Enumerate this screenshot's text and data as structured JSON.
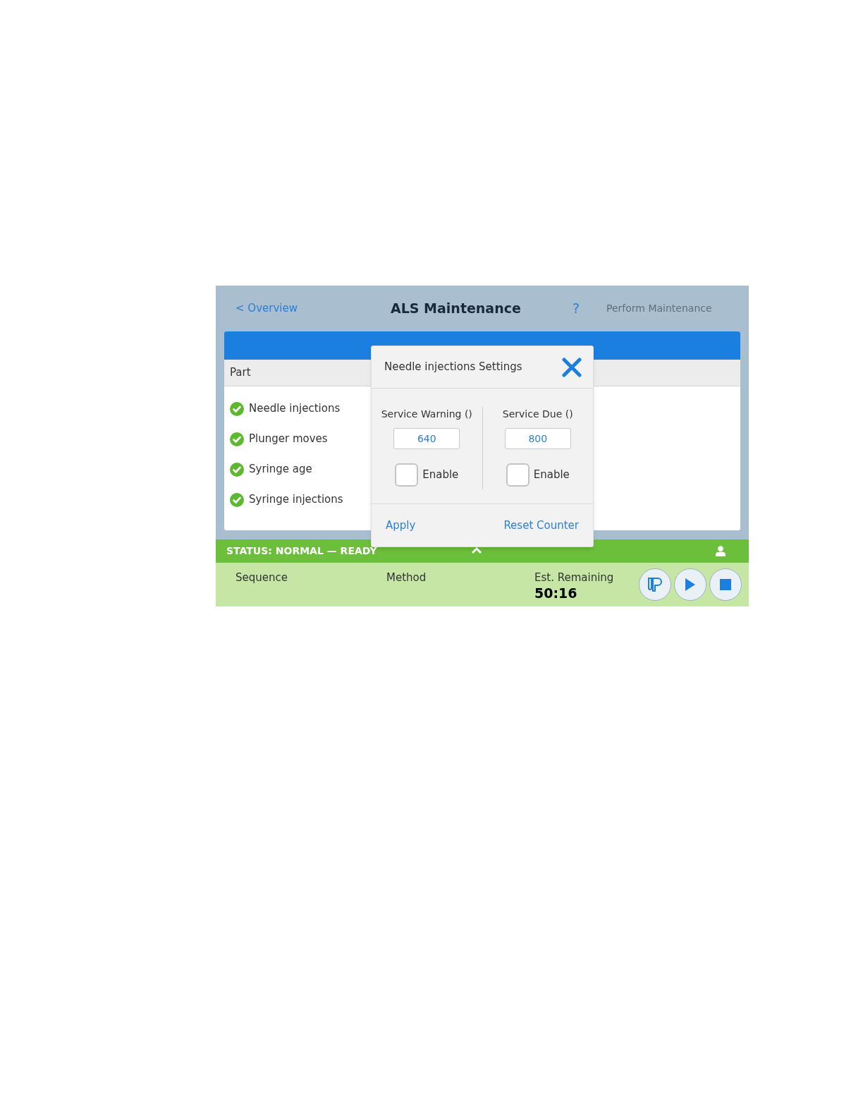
{
  "header": {
    "back_link": "< Overview",
    "title": "ALS Maintenance",
    "help": "?",
    "action": {
      "label": "Perform Maintenance",
      "disabled": true
    }
  },
  "table": {
    "columns": [
      "Part"
    ],
    "rows": [
      {
        "part": "Needle injections",
        "ok": true
      },
      {
        "part": "Plunger moves",
        "ok": true
      },
      {
        "part": "Syringe age",
        "ok": true
      },
      {
        "part": "Syringe injections",
        "ok": true
      }
    ]
  },
  "dialog": {
    "title": "Needle injections Settings",
    "fields": [
      {
        "label": "Service Warning ()",
        "value": "640",
        "enable_label": "Enable",
        "checked": false
      },
      {
        "label": "Service Due ()",
        "value": "800",
        "enable_label": "Enable",
        "checked": false
      }
    ],
    "buttons": [
      "Apply",
      "Reset Counter"
    ]
  },
  "status_bar": {
    "text": "STATUS: NORMAL — READY",
    "expanded": false
  },
  "run_panel": {
    "sequence_label": "Sequence",
    "method_label": "Method",
    "remaining_label": "Est. Remaining",
    "remaining_value": "50:16"
  }
}
